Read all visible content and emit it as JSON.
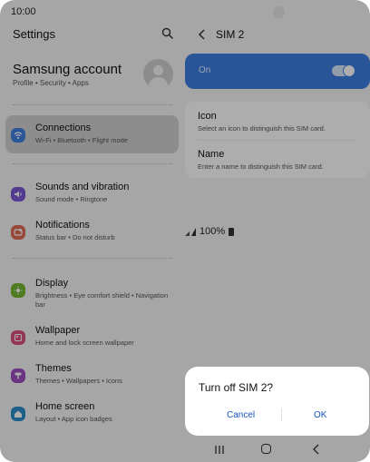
{
  "status_bar": {
    "time": "10:00",
    "battery": "100%"
  },
  "settings": {
    "title": "Settings",
    "account": {
      "title": "Samsung account",
      "subtitle": "Profile  •  Security  •  Apps"
    },
    "items": [
      {
        "title": "Connections",
        "subtitle": "Wi-Fi  •  Bluetooth  •  Flight mode",
        "icon": "wifi-icon",
        "color": "#3f7fe0"
      },
      {
        "title": "Sounds and vibration",
        "subtitle": "Sound mode  •  Ringtone",
        "icon": "volume-icon",
        "color": "#7a57d6"
      },
      {
        "title": "Notifications",
        "subtitle": "Status bar  •  Do not disturb",
        "icon": "notification-icon",
        "color": "#e06a55"
      },
      {
        "title": "Display",
        "subtitle": "Brightness  •  Eye comfort shield  •  Navigation bar",
        "icon": "sun-icon",
        "color": "#74b832"
      },
      {
        "title": "Wallpaper",
        "subtitle": "Home and lock screen wallpaper",
        "icon": "wallpaper-icon",
        "color": "#d94f7c"
      },
      {
        "title": "Themes",
        "subtitle": "Themes  •  Wallpapers  •  Icons",
        "icon": "themes-icon",
        "color": "#9b4ec1"
      },
      {
        "title": "Home screen",
        "subtitle": "Layout  •  App icon badges",
        "icon": "home-icon",
        "color": "#2a8cc9"
      }
    ]
  },
  "sim": {
    "title": "SIM 2",
    "toggle_label": "On",
    "toggle_on": true,
    "options": [
      {
        "title": "Icon",
        "subtitle": "Select an icon to distinguish this SIM card."
      },
      {
        "title": "Name",
        "subtitle": "Enter a name to distinguish this SIM card."
      }
    ]
  },
  "dialog": {
    "title": "Turn off SIM 2?",
    "cancel": "Cancel",
    "ok": "OK"
  },
  "colors": {
    "accent": "#3b7de0",
    "dialog_button": "#1a56c0"
  }
}
